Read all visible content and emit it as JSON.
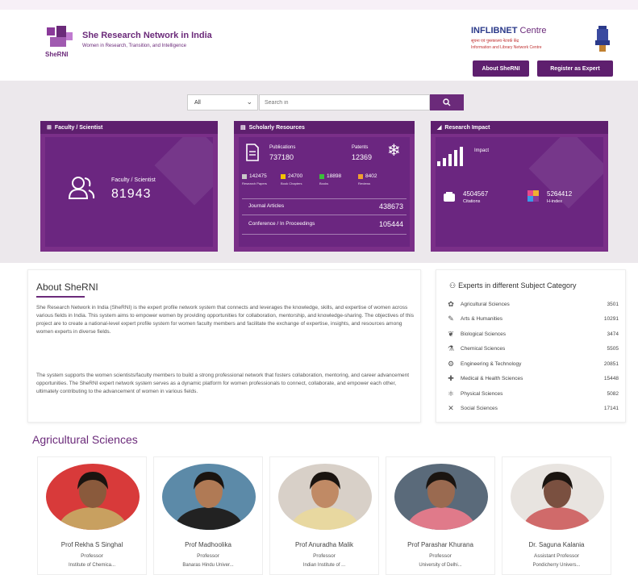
{
  "header": {
    "brand_title": "She Research Network in India",
    "brand_subtitle": "Women in Research, Transition, and Intelligence",
    "logo_text": "SheRNI",
    "inflibnet_title": "INFLIBNET",
    "inflibnet_centre": "Centre",
    "inflibnet_line1": "सूचना एवं पुस्तकालय नेटवर्क केंद्र",
    "inflibnet_line2": "Information and Library Network Centre",
    "about_button": "About SheRNI",
    "register_button": "Register as Expert"
  },
  "search": {
    "select_value": "All",
    "placeholder": "Search in"
  },
  "cards": {
    "faculty": {
      "title": "Faculty / Scientist",
      "label": "Faculty / Scientist",
      "value": "81943"
    },
    "resources": {
      "title": "Scholarly Resources",
      "publications_label": "Publications",
      "publications_value": "737180",
      "patents_label": "Patents",
      "patents_value": "12369",
      "stats": [
        {
          "value": "142475",
          "label": "Research Papers",
          "color": "#c9c9c9"
        },
        {
          "value": "24700",
          "label": "Book Chapters",
          "color": "#f2c200"
        },
        {
          "value": "18898",
          "label": "Books",
          "color": "#3bbf3b"
        },
        {
          "value": "8402",
          "label": "Reviews",
          "color": "#f0a030"
        }
      ],
      "rows": [
        {
          "label": "Journal Articles",
          "value": "438673"
        },
        {
          "label": "Conference / In Proceedings",
          "value": "105444"
        }
      ]
    },
    "impact": {
      "title": "Research Impact",
      "label": "Impact",
      "citations_value": "4504567",
      "citations_label": "Citations",
      "hindex_value": "5264412",
      "hindex_label": "H-index"
    }
  },
  "about": {
    "title": "About SheRNI",
    "para1": "She Research Network in India (SheRNI) is the expert profile network system that connects and leverages the knowledge, skills, and expertise of women across various fields in India. This system aims to empower women by providing opportunities for collaboration, mentorship, and knowledge-sharing. The objectives of this project are to create a national-level expert profile system for women faculty members and facilitate the exchange of expertise, insights, and resources among women experts in diverse fields.",
    "para2": "The system supports the women scientists/faculty members to build a strong professional network that fosters collaboration, mentoring, and career advancement opportunities. The SheRNI expert network system serves as a dynamic platform for women professionals to connect, collaborate, and empower each other, ultimately contributing to the advancement of women in various fields."
  },
  "experts": {
    "title": "Experts in different Subject Category",
    "items": [
      {
        "icon": "agriculture-icon",
        "label": "Agricultural Sciences",
        "count": "3501"
      },
      {
        "icon": "arts-icon",
        "label": "Arts & Humanities",
        "count": "10291"
      },
      {
        "icon": "leaf-icon",
        "label": "Biological Sciences",
        "count": "3474"
      },
      {
        "icon": "flask-icon",
        "label": "Chemical Sciences",
        "count": "5505"
      },
      {
        "icon": "gear-icon",
        "label": "Engineering & Technology",
        "count": "20851"
      },
      {
        "icon": "medical-icon",
        "label": "Medical & Health Sciences",
        "count": "15448"
      },
      {
        "icon": "atom-icon",
        "label": "Physical Sciences",
        "count": "5082"
      },
      {
        "icon": "social-icon",
        "label": "Social Sciences",
        "count": "17141"
      }
    ]
  },
  "agri": {
    "title": "Agricultural Sciences",
    "people": [
      {
        "name": "Prof Rekha S Singhal",
        "role": "Professor",
        "inst": "Institute of Chemica...",
        "bg": "#d83a3a",
        "skin": "#8a5a3c",
        "cloth": "#c8a060"
      },
      {
        "name": "Prof Madhoolika",
        "role": "Professor",
        "inst": "Banaras Hindu Univer...",
        "bg": "#5c8aa8",
        "skin": "#b07a55",
        "cloth": "#222222"
      },
      {
        "name": "Prof Anuradha Malik",
        "role": "Professor",
        "inst": "Indian Institute of ...",
        "bg": "#d8d0c8",
        "skin": "#c08a65",
        "cloth": "#e8d8a0"
      },
      {
        "name": "Prof Parashar Khurana",
        "role": "Professor",
        "inst": "University of Delhi...",
        "bg": "#5a6a7a",
        "skin": "#9a6a50",
        "cloth": "#e07a8a"
      },
      {
        "name": "Dr. Saguna Kalania",
        "role": "Assistant Professor",
        "inst": "Pondicherry Univers...",
        "bg": "#e8e4e0",
        "skin": "#7a5040",
        "cloth": "#d06a6a"
      }
    ]
  }
}
